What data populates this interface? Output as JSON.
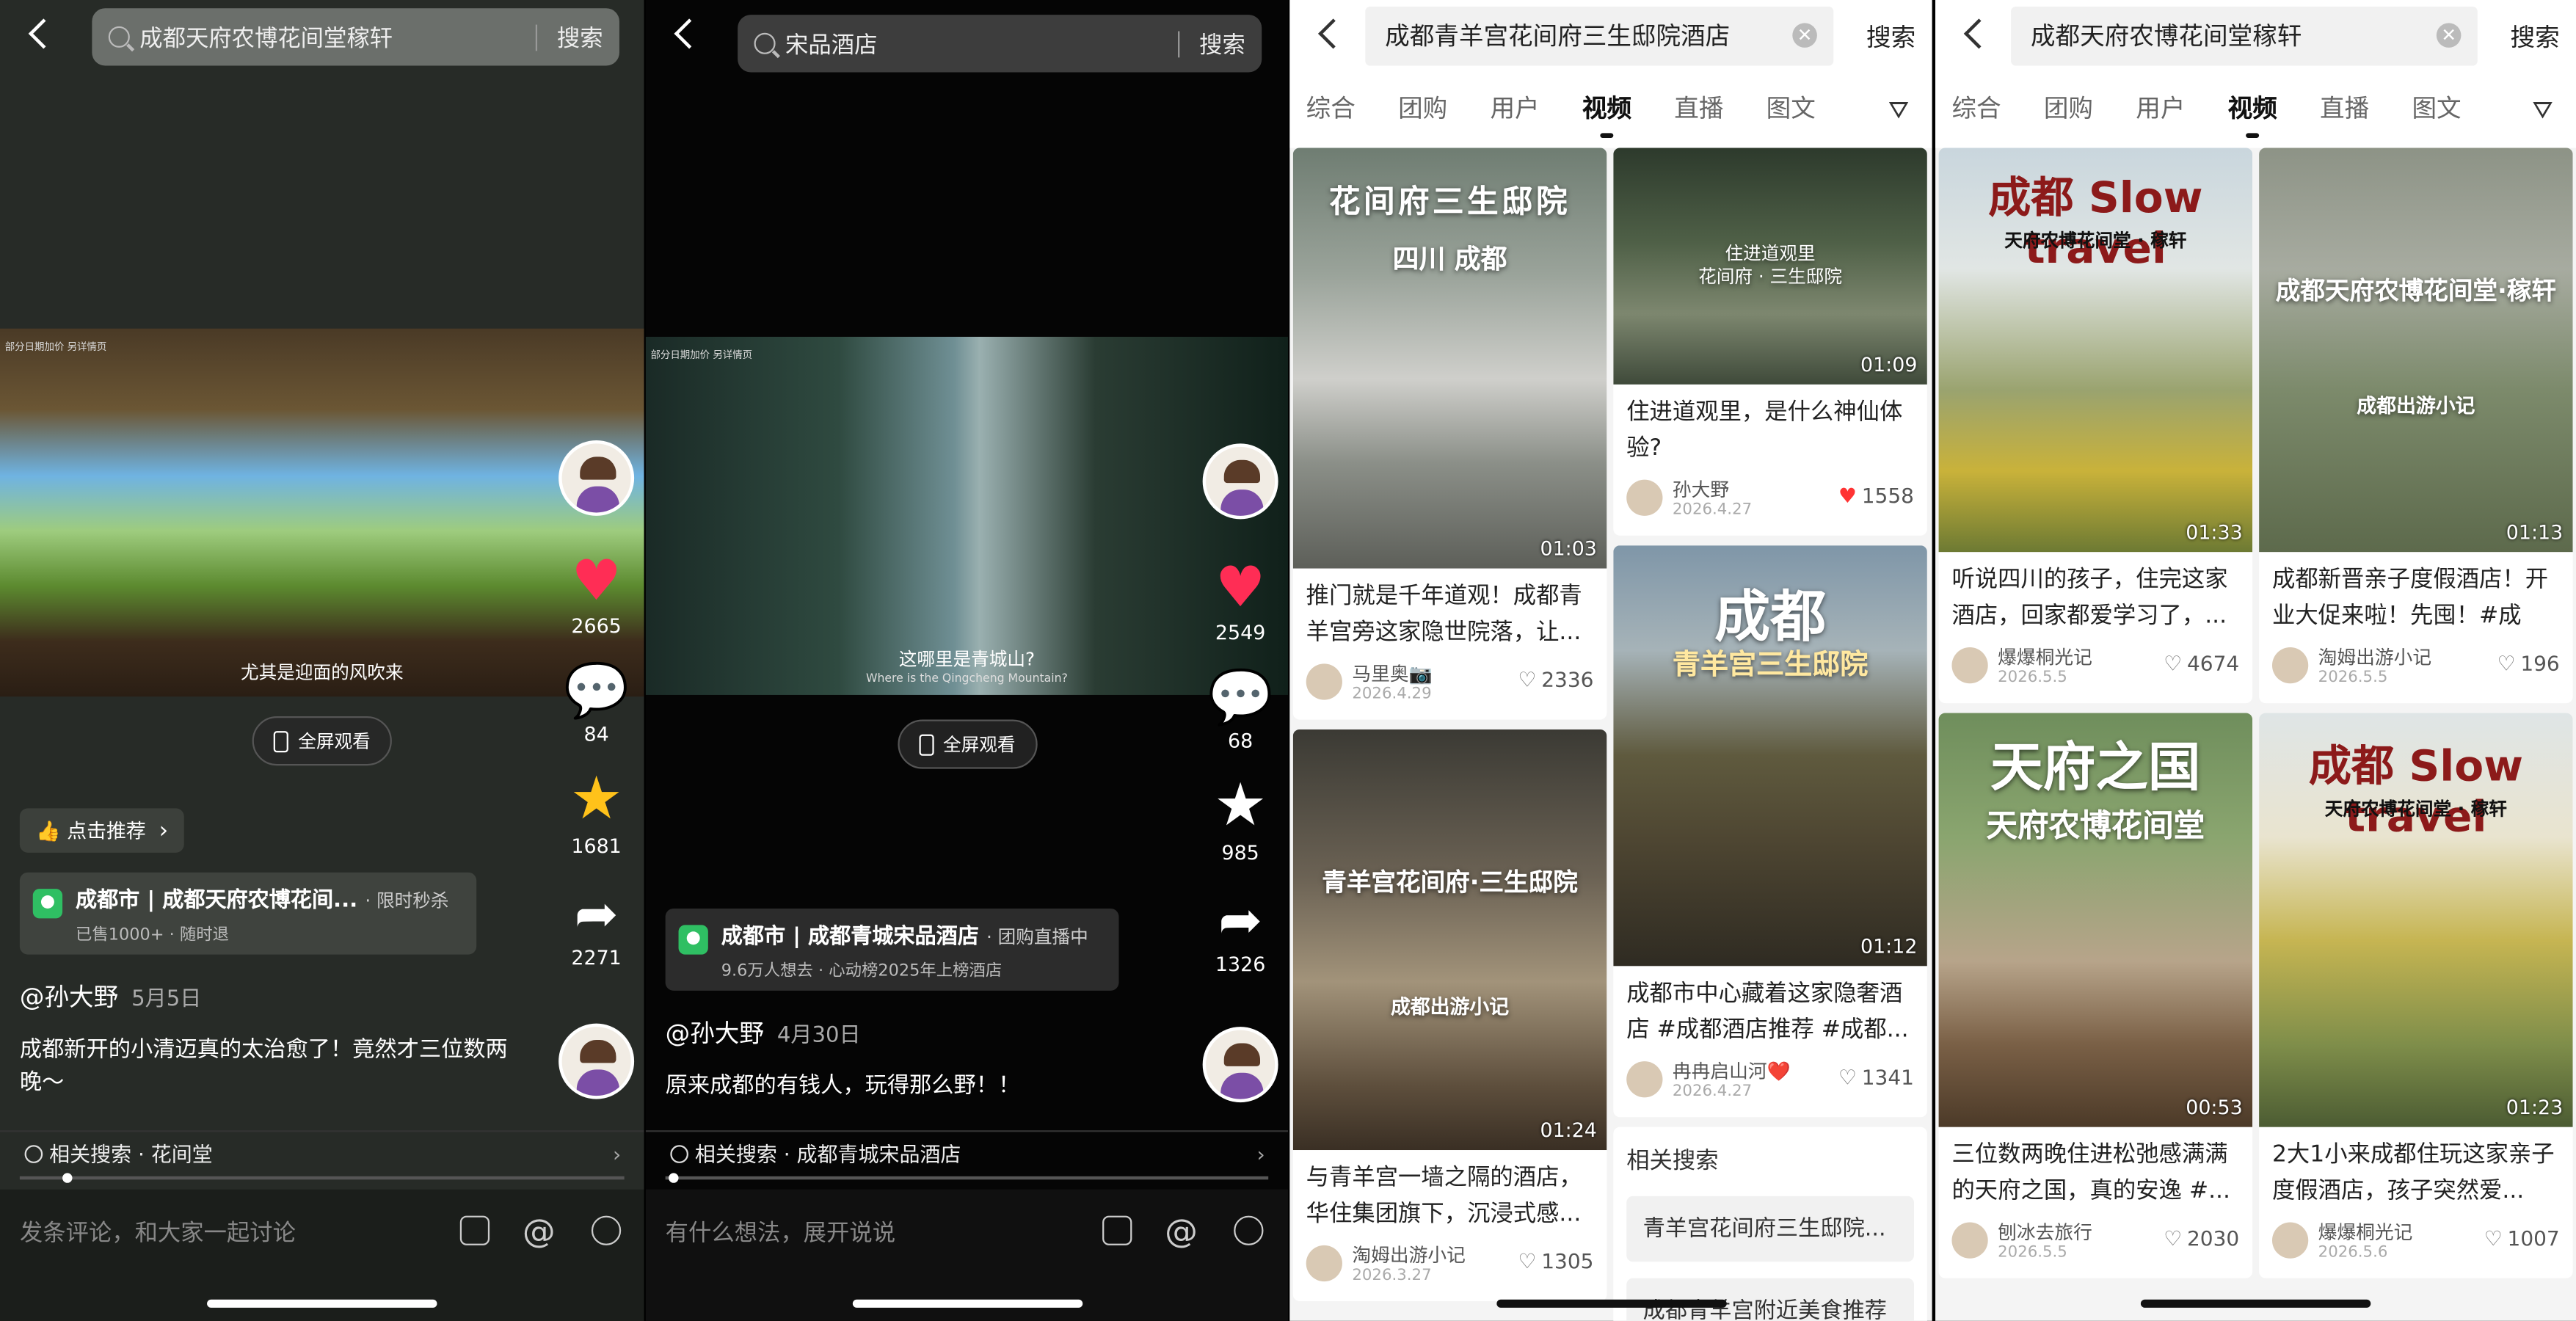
{
  "panel1": {
    "search_query": "成都天府农博花间堂稼轩",
    "search_button": "搜索",
    "video_tag": "部分日期加价 另详情页",
    "caption": "尤其是迎面的风吹来",
    "fullscreen": "全屏观看",
    "likes": "2665",
    "comments": "84",
    "favorites": "1681",
    "shares": "2271",
    "recommend": "点击推荐",
    "poi_city": "成都市",
    "poi_name": "成都天府农博花间...",
    "poi_tag": "· 限时秒杀",
    "poi_sub": "已售1000+ · 随时退",
    "author": "@孙大野",
    "date": "5月5日",
    "desc": "成都新开的小清迈真的太治愈了！竟然才三位数两晚～",
    "related": "相关搜索 · 花间堂",
    "comment_placeholder": "发条评论，和大家一起讨论"
  },
  "panel2": {
    "search_query": "宋品酒店",
    "search_button": "搜索",
    "video_tag": "部分日期加价 另详情页",
    "caption": "这哪里是青城山?",
    "caption_en": "Where is the Qingcheng Mountain?",
    "fullscreen": "全屏观看",
    "likes": "2549",
    "comments": "68",
    "favorites": "985",
    "shares": "1326",
    "poi_city": "成都市",
    "poi_name": "成都青城宋品酒店",
    "poi_tag": "· 团购直播中",
    "poi_sub": "9.6万人想去 · 心动榜2025年上榜酒店",
    "author": "@孙大野",
    "date": "4月30日",
    "desc": "原来成都的有钱人，玩得那么野！！",
    "related": "相关搜索 · 成都青城宋品酒店",
    "comment_placeholder": "有什么想法，展开说说"
  },
  "panel3": {
    "search_query": "成都青羊宫花间府三生邸院酒店",
    "search_button": "搜索",
    "tabs": [
      "综合",
      "团购",
      "用户",
      "视频",
      "直播",
      "图文"
    ],
    "left": [
      {
        "overlay": "花间府三生邸院",
        "overlay2": "四川 成都",
        "duration": "01:03",
        "title": "推门就是千年道观！成都青羊宫旁这家隐世院落，让...",
        "author": "马里奥📷",
        "date": "2026.4.29",
        "likes": "2336"
      },
      {
        "overlay": "青羊宫花间府·三生邸院",
        "overlay2": "成都出游小记",
        "duration": "01:24",
        "title": "与青羊宫一墙之隔的酒店，华住集团旗下，沉浸式感...",
        "author": "淘姆出游小记",
        "date": "2026.3.27",
        "likes": "1305"
      }
    ],
    "right": [
      {
        "overlay": "住进道观里",
        "overlay2": "花间府 · 三生邸院",
        "duration": "01:09",
        "title": "住进道观里，是什么神仙体验?",
        "author": "孙大野",
        "date": "2026.4.27",
        "likes": "1558"
      },
      {
        "overlay": "成都",
        "overlay2": "青羊宫三生邸院",
        "duration": "01:12",
        "title": "成都市中心藏着这家隐奢酒店 #成都酒店推荐 #成都...",
        "author": "冉冉启山河❤️",
        "date": "2026.4.27",
        "likes": "1341"
      }
    ],
    "related_title": "相关搜索",
    "related": [
      "青羊宫花间府三生邸院...",
      "成都青羊宫附近美食推荐"
    ]
  },
  "panel4": {
    "search_query": "成都天府农博花间堂稼轩",
    "search_button": "搜索",
    "tabs": [
      "综合",
      "团购",
      "用户",
      "视频",
      "直播",
      "图文"
    ],
    "left": [
      {
        "overlay": "成都 Slow travel",
        "overlay2": "天府农博花间堂 · 稼轩",
        "duration": "01:33",
        "title": "听说四川的孩子，住完这家酒店，回家都爱学习了，...",
        "author": "爆爆桐光记",
        "date": "2026.5.5",
        "likes": "4674"
      },
      {
        "overlay": "天府之国",
        "overlay2": "天府农博花间堂",
        "duration": "00:53",
        "title": "三位数两晚住进松弛感满满的天府之国，真的安逸 #...",
        "author": "刨冰去旅行",
        "date": "2026.5.5",
        "likes": "2030"
      }
    ],
    "right": [
      {
        "overlay": "成都天府农博花间堂·稼轩",
        "overlay2": "成都出游小记",
        "duration": "01:13",
        "title": "成都新晋亲子度假酒店！开业大促来啦！先囤！#成都...",
        "author": "淘姆出游小记",
        "date": "2026.5.5",
        "likes": "196"
      },
      {
        "overlay": "成都 Slow travel",
        "overlay2": "天府农博花间堂 · 稼轩",
        "duration": "01:23",
        "title": "2大1小来成都住玩这家亲子度假酒店，孩子突然爱...",
        "author": "爆爆桐光记",
        "date": "2026.5.6",
        "likes": "1007"
      }
    ]
  }
}
